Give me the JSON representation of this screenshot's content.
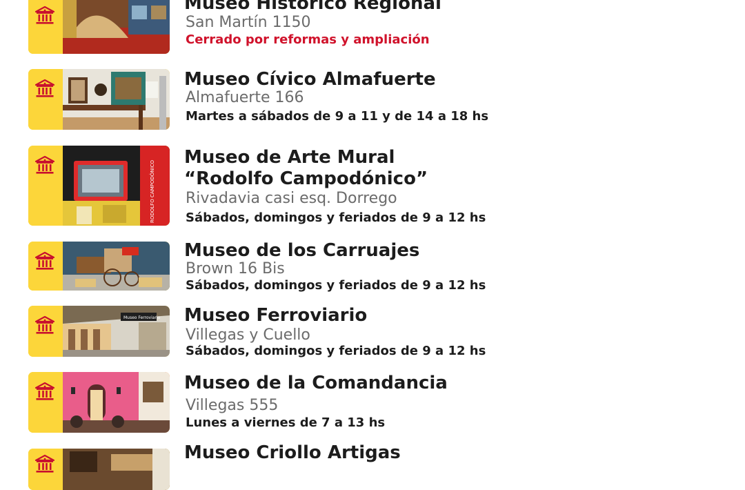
{
  "museums": [
    {
      "title": "Museo Histórico Regional",
      "address": "San Martín 1150",
      "hours": "Cerrado por reformas y ampliación",
      "status": "closed",
      "icon": "museum-building-icon"
    },
    {
      "title": "Museo Cívico Almafuerte",
      "address": "Almafuerte 166",
      "hours": "Martes a sábados de 9 a 11 y de 14 a 18 hs",
      "icon": "museum-building-icon"
    },
    {
      "title_line1": "Museo de Arte Mural",
      "title_line2": "“Rodolfo Campodónico”",
      "address": "Rivadavia casi esq. Dorrego",
      "hours": "Sábados, domingos y feriados de 9 a 12 hs",
      "photo_text": "RODOLFO CAMPODÓNICO",
      "icon": "museum-building-icon"
    },
    {
      "title": "Museo de los Carruajes",
      "address": "Brown 16 Bis",
      "hours": "Sábados, domingos y feriados de 9 a 12 hs",
      "icon": "museum-building-icon"
    },
    {
      "title": "Museo Ferroviario",
      "address": "Villegas y Cuello",
      "hours": "Sábados, domingos y feriados de 9 a 12 hs",
      "photo_text": "Museo Ferroviario",
      "icon": "museum-building-icon"
    },
    {
      "title": "Museo de la Comandancia",
      "address": "Villegas 555",
      "hours": "Lunes a viernes de 7 a 13 hs",
      "icon": "museum-building-icon"
    },
    {
      "title": "Museo Criollo Artigas",
      "icon": "museum-building-icon"
    }
  ],
  "colors": {
    "accent_yellow": "#fcd63a",
    "icon_red": "#c8102e",
    "closed_red": "#d0122b",
    "text_dark": "#1c1c1c",
    "text_gray": "#6b6b6b"
  }
}
